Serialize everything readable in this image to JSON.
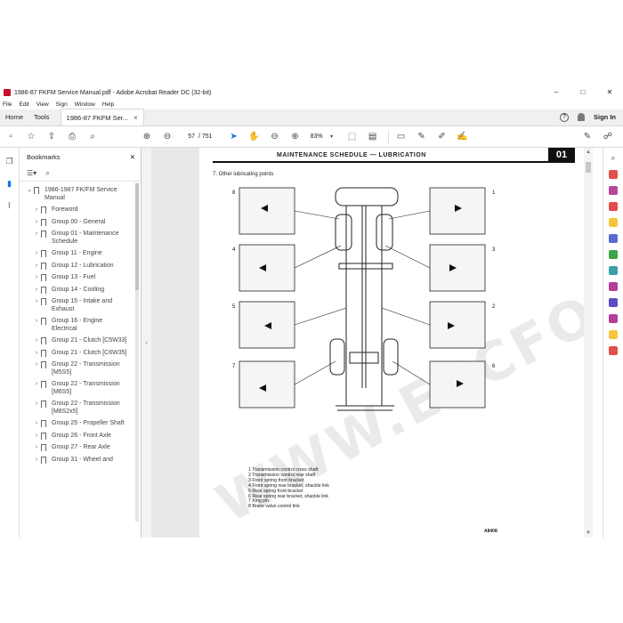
{
  "window": {
    "title": "1986-87 FKFM Service Manual.pdf - Adobe Acrobat Reader DC (32-bit)",
    "minimize": "–",
    "maximize": "□",
    "close": "✕"
  },
  "menu": [
    "File",
    "Edit",
    "View",
    "Sign",
    "Window",
    "Help"
  ],
  "tabs": {
    "home": "Home",
    "tools": "Tools",
    "doc": "1986-87 FKFM Ser...",
    "doc_close": "×",
    "help_icon": "?",
    "bell_icon": "🔔",
    "signin": "Sign In"
  },
  "toolbar": {
    "page_current": "57",
    "page_total": "/ 751",
    "zoom": "83%"
  },
  "bookmarks": {
    "title": "Bookmarks",
    "close": "✕",
    "root": "1986-1987 FK/FM Service Manual",
    "items": [
      "Foreword",
      "Group 00 - General",
      "Group 01 - Maintenance Schedule",
      "Group 11 - Engine",
      "Group 12 - Lubrication",
      "Group 13 - Fuel",
      "Group 14 - Cooling",
      "Group 15 - Intake and Exhaust",
      "Group 16 - Engine Electrical",
      "Group 21 - Clutch [C5W33]",
      "Group 21 - Clutch [C6W35]",
      "Group 22 - Transmission [M5S5]",
      "Group 22 - Transmission [M6S5]",
      "Group 22 - Transmission [M8S2x5]",
      "Group 25 - Propeller Shaft",
      "Group 26 - Front Axle",
      "Group 27 - Rear Axle",
      "Group 31 - Wheel and"
    ]
  },
  "page": {
    "header": "MAINTENANCE SCHEDULE — LUBRICATION",
    "number": "01",
    "section": "7.   Other lubricating points",
    "callouts": [
      "1",
      "2",
      "3",
      "4",
      "5",
      "6",
      "7",
      "8"
    ],
    "legend": [
      "1   Transmission control cross shaft",
      "2   Transmission control rear shaft",
      "3   Front spring front bracket",
      "4   Front spring rear bracket, shackle link",
      "5   Rear spring front bracket",
      "6   Rear spring rear bracket, shackle link",
      "7   King pin",
      "8   Brake valve control link"
    ],
    "figure_code": "A8408",
    "watermark": "WWW.EPCFOTO.COM"
  }
}
